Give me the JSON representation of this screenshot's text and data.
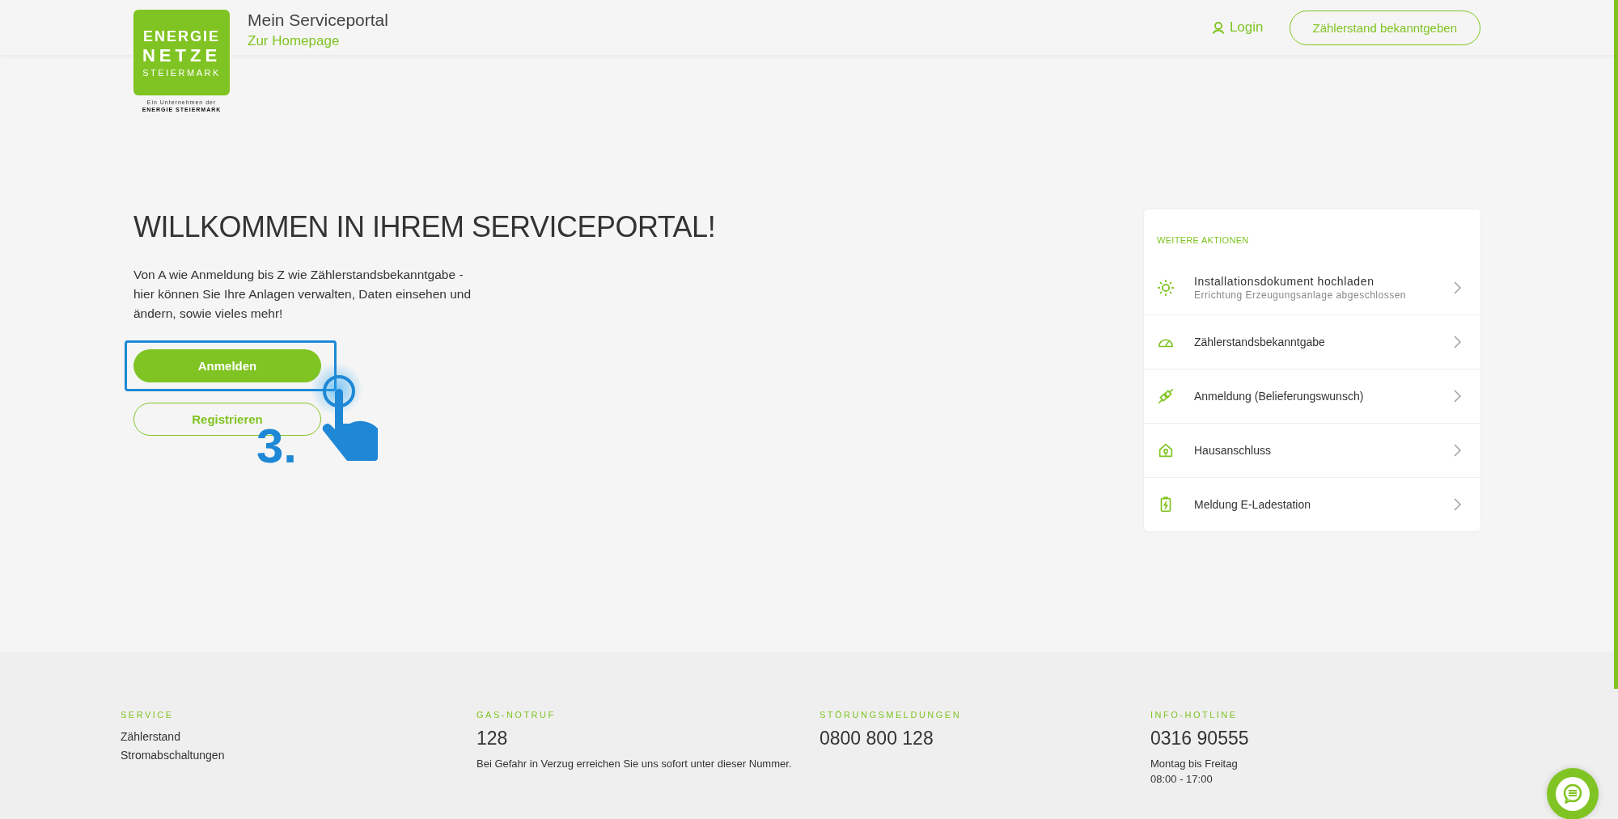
{
  "header": {
    "logo": {
      "lines": [
        "ENERGIE",
        "NETZE",
        "STEIERMARK"
      ],
      "tagline": [
        "Ein Unternehmen der",
        "ENERGIE STEIERMARK"
      ]
    },
    "title": "Mein Serviceportal",
    "homepage_link": "Zur Homepage",
    "login": "Login",
    "cta_button": "Zählerstand bekanntgeben"
  },
  "welcome": {
    "heading": "WILLKOMMEN IN IHREM SERVICEPORTAL!",
    "text": "Von A wie Anmeldung bis Z wie Zählerstandsbekanntgabe - hier können Sie Ihre Anlagen verwalten, Daten einsehen und ändern, sowie vieles mehr!",
    "buttons": [
      {
        "label": "Anmelden",
        "kind": "primary",
        "highlighted": true
      },
      {
        "label": "Registrieren",
        "kind": "secondary",
        "highlighted": false
      }
    ]
  },
  "tutorial": {
    "step": "3."
  },
  "actions": {
    "title": "WEITERE AKTIONEN",
    "items": [
      {
        "kind": "sun",
        "label": "Installationsdokument hochladen",
        "sublabel": "Errichtung Erzeugungsanlage abgeschlossen"
      },
      {
        "kind": "gauge",
        "label": "Zählerstandsbekanntgabe"
      },
      {
        "kind": "plug",
        "label": "Anmeldung (Belieferungswunsch)"
      },
      {
        "kind": "house",
        "label": "Hausanschluss"
      },
      {
        "kind": "battery",
        "label": "Meldung E-Ladestation"
      }
    ]
  },
  "footer": {
    "columns": [
      {
        "title": "SERVICE",
        "kind": "links",
        "links": [
          "Zählerstand",
          "Stromabschaltungen"
        ]
      },
      {
        "title": "GAS-NOTRUF",
        "kind": "phone",
        "number": "128",
        "note": [
          "Bei Gefahr in Verzug erreichen Sie uns sofort unter dieser Nummer."
        ]
      },
      {
        "title": "STÖRUNGSMELDUNGEN",
        "kind": "phone",
        "number": "0800 800 128"
      },
      {
        "title": "INFO-HOTLINE",
        "kind": "phone",
        "number": "0316 90555",
        "note": [
          "Montag bis Freitag",
          "08:00 - 17:00"
        ]
      }
    ]
  }
}
